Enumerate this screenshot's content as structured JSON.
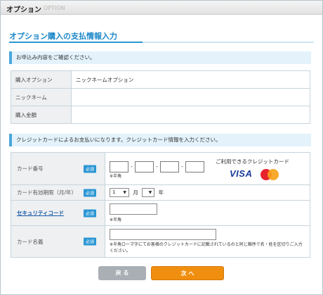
{
  "titlebar": {
    "title": "オプション",
    "subtitle": "OPTION"
  },
  "heading": "オプション購入の支払情報入力",
  "notice1": "お申込み内容をご確認ください。",
  "order": {
    "rows": [
      {
        "label": "購入オプション",
        "value": "ニックネームオプション"
      },
      {
        "label": "ニックネーム",
        "value": ""
      },
      {
        "label": "購入金額",
        "value": ""
      }
    ]
  },
  "notice2": "クレジットカードによるお支払いになります。クレジットカード情報を入力ください。",
  "form": {
    "required_badge": "必須",
    "card_number": {
      "label": "カード番号",
      "note": "※半角",
      "separator": "-",
      "accepted_label": "ご利用できるクレジットカード",
      "brands": [
        "VISA",
        "Mastercard"
      ]
    },
    "expiry": {
      "label": "カード有効期限（月/年）",
      "month": "1",
      "month_unit": "月",
      "year": "",
      "year_unit": "年"
    },
    "security": {
      "label": "セキュリティコード",
      "note": "※半角"
    },
    "holder": {
      "label": "カード名義",
      "note": "※半角ローマ字にてお客様のクレジットカードに記載されているのと同じ順序で名・姓を区切りご入力ください。"
    }
  },
  "buttons": {
    "back": "戻 る",
    "next": "次 へ"
  },
  "colors": {
    "accent": "#2a96d4",
    "next_button": "#f08f0f",
    "back_button": "#a9afb5"
  }
}
